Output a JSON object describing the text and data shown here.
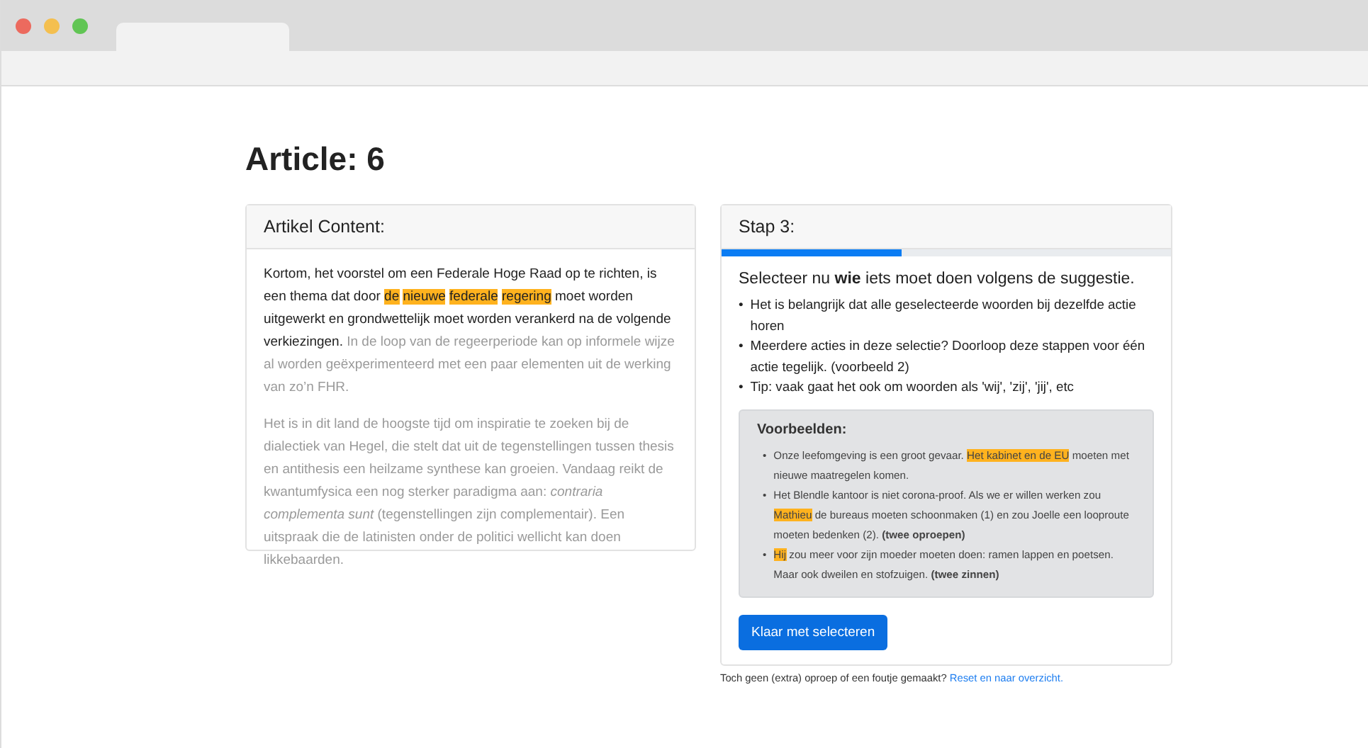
{
  "page_title": "Article: 6",
  "article": {
    "header": "Artikel Content:",
    "paragraphs": [
      [
        {
          "text": "Kortom, het voorstel om een Federale Hoge Raad op te richten, is een thema dat door ",
          "kind": "normal"
        },
        {
          "text": "de nieuwe federale regering",
          "kind": "highlight"
        },
        {
          "text": " moet worden uitgewerkt en grondwettelijk moet worden verankerd na de volgende verkiezingen.",
          "kind": "normal"
        },
        {
          "text": " In de loop van de regeerperiode kan op informele wijze al worden geëxperimenteerd met een paar elementen uit de werking van zo’n FHR.",
          "kind": "faded"
        }
      ],
      [
        {
          "text": "Het is in dit land de hoogste tijd om inspiratie te zoeken bij de dialectiek van Hegel, die stelt dat uit de tegenstellingen tussen thesis en antithesis een heilzame synthese kan groeien. Vandaag reikt de kwantumfysica een nog sterker paradigma aan: *contraria complementa sunt* (tegenstellingen zijn complementair). Een uitspraak die de latinisten onder de politici wellicht kan doen likkebaarden.",
          "kind": "faded"
        }
      ]
    ]
  },
  "step": {
    "header": "Stap 3:",
    "progress": {
      "level": 0.4
    },
    "instruction": "Selecteer nu **wie** iets moet doen volgens de suggestie.",
    "tips": [
      {
        "marker": "•",
        "text": "Het is belangrijk dat alle geselecteerde woorden bij dezelfde actie horen"
      },
      {
        "marker": "•",
        "text": "Meerdere acties in deze selectie? Doorloop deze stappen voor één actie tegelijk. (voorbeeld 2)"
      },
      {
        "marker": "•",
        "text": "Tip: vaak gaat het ook om woorden als 'wij', 'zij', 'jij', etc"
      }
    ],
    "examples": {
      "title": "Voorbeelden:",
      "items": [
        {
          "marker": "•",
          "segments": [
            {
              "text": "Onze leefomgeving is een groot gevaar. ",
              "kind": "normal"
            },
            {
              "text": "Het kabinet en de EU",
              "kind": "highlight"
            },
            {
              "text": " moeten met nieuwe maatregelen komen.",
              "kind": "normal"
            }
          ]
        },
        {
          "marker": "•",
          "segments": [
            {
              "text": "Het Blendle kantoor is niet corona-proof. Als we er willen werken zou ",
              "kind": "normal"
            },
            {
              "text": "Mathieu",
              "kind": "highlight"
            },
            {
              "text": " de bureaus moeten schoonmaken (1) en zou Joelle een looproute moeten bedenken (2). **(twee oproepen)**",
              "kind": "normal"
            }
          ]
        },
        {
          "marker": "•",
          "segments": [
            {
              "text": "Hij",
              "kind": "highlight"
            },
            {
              "text": " zou meer voor zijn moeder moeten doen: ramen lappen en poetsen. Maar ook dweilen en stofzuigen. **(twee zinnen)**",
              "kind": "normal"
            }
          ]
        }
      ]
    },
    "button": "Klaar met selecteren"
  },
  "footer": {
    "text": "Toch geen (extra) oproep of een foutje gemaakt?",
    "link": "Reset en naar overzicht."
  }
}
